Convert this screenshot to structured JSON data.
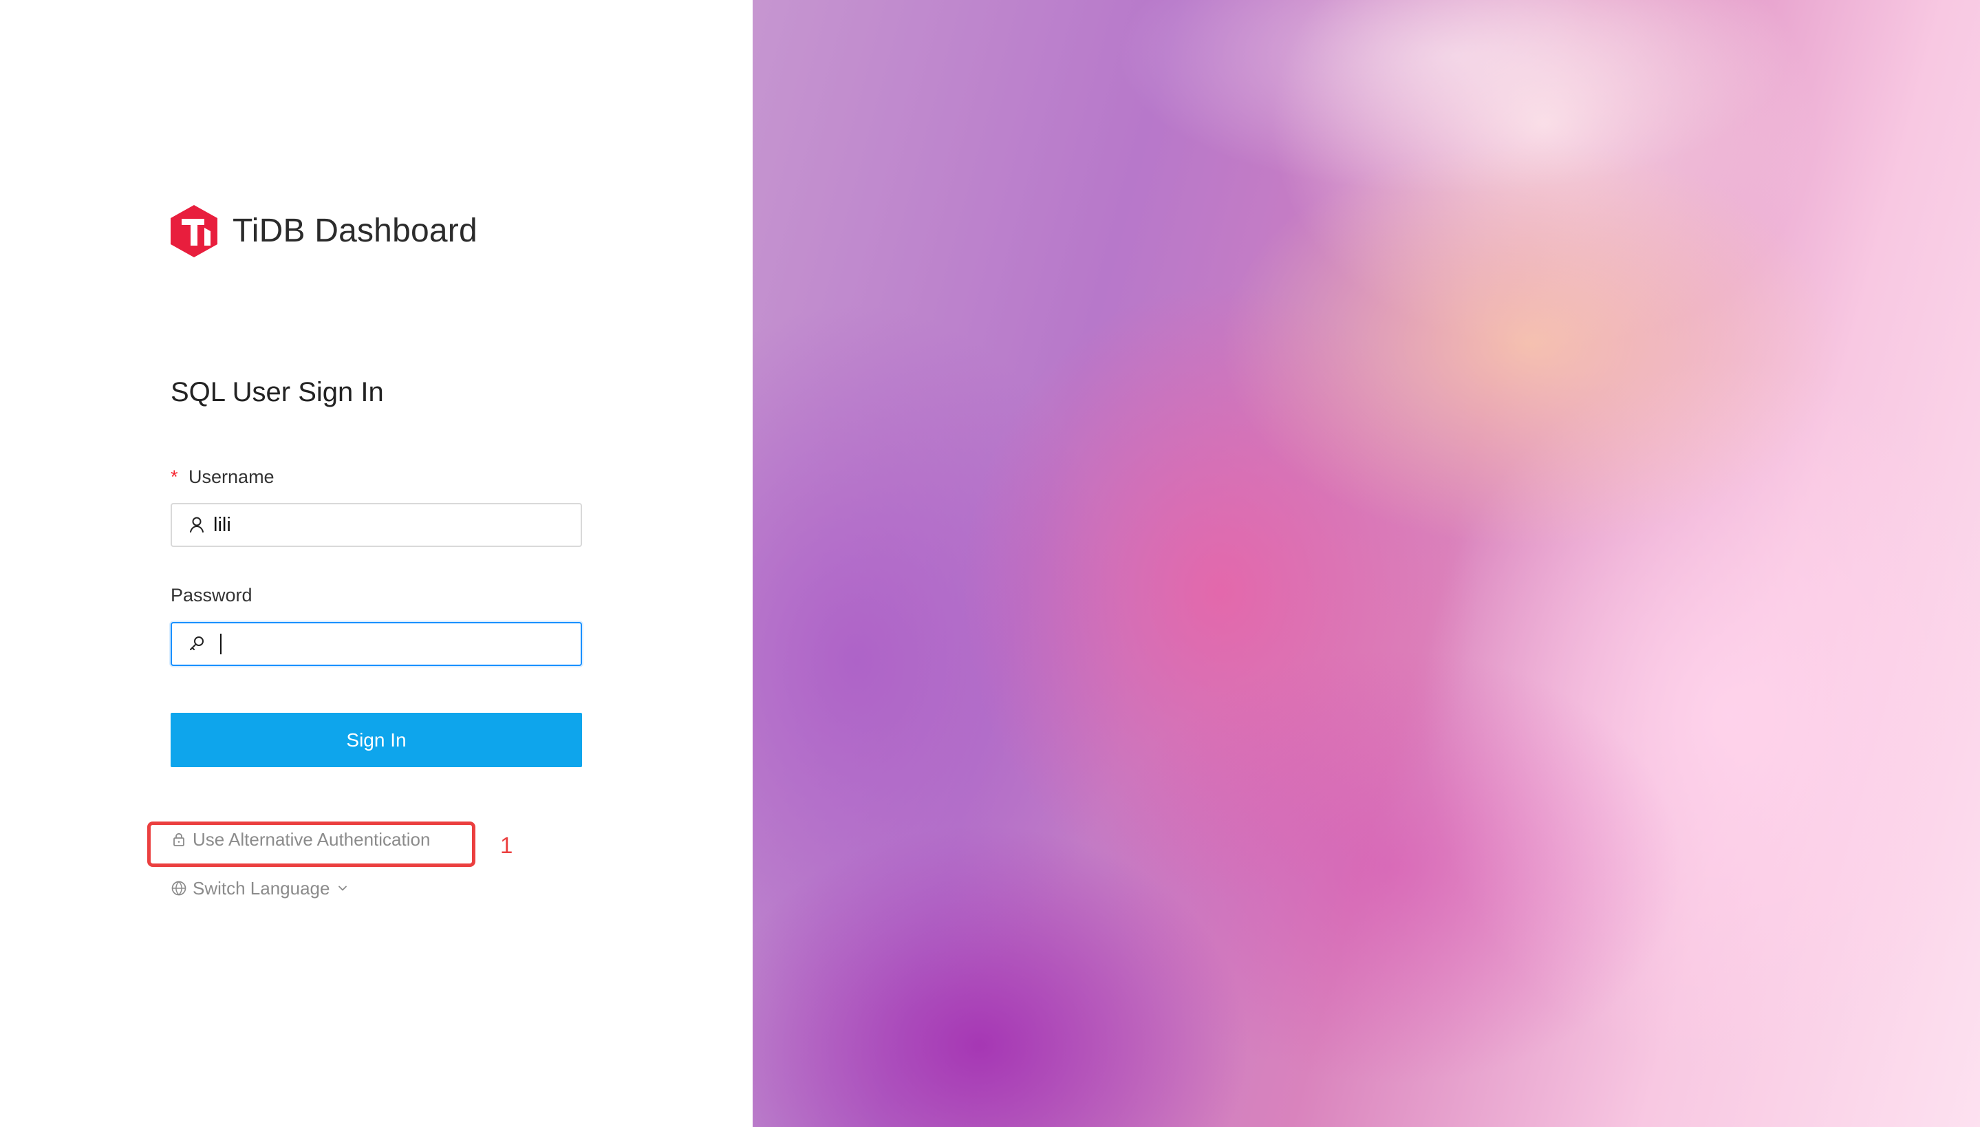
{
  "brand": {
    "title": "TiDB Dashboard",
    "logo_icon": "tidb-logo-icon",
    "logo_color": "#e81e3d"
  },
  "form": {
    "title": "SQL User Sign In",
    "username": {
      "required_mark": "*",
      "label": "Username",
      "value": "lili",
      "icon": "user-icon"
    },
    "password": {
      "label": "Password",
      "value": "",
      "icon": "key-icon"
    },
    "sign_in_label": "Sign In"
  },
  "links": {
    "alternative_authentication": "Use Alternative Authentication",
    "alternative_authentication_icon": "lock-icon",
    "switch_language": "Switch Language",
    "switch_language_icon": "globe-icon",
    "switch_language_chevron_icon": "chevron-down-icon"
  },
  "annotation": {
    "number": "1",
    "color": "#eb3f3f"
  },
  "colors": {
    "primary": "#0ea5ec",
    "focus_border": "#1890ff",
    "required": "#f5222d"
  }
}
